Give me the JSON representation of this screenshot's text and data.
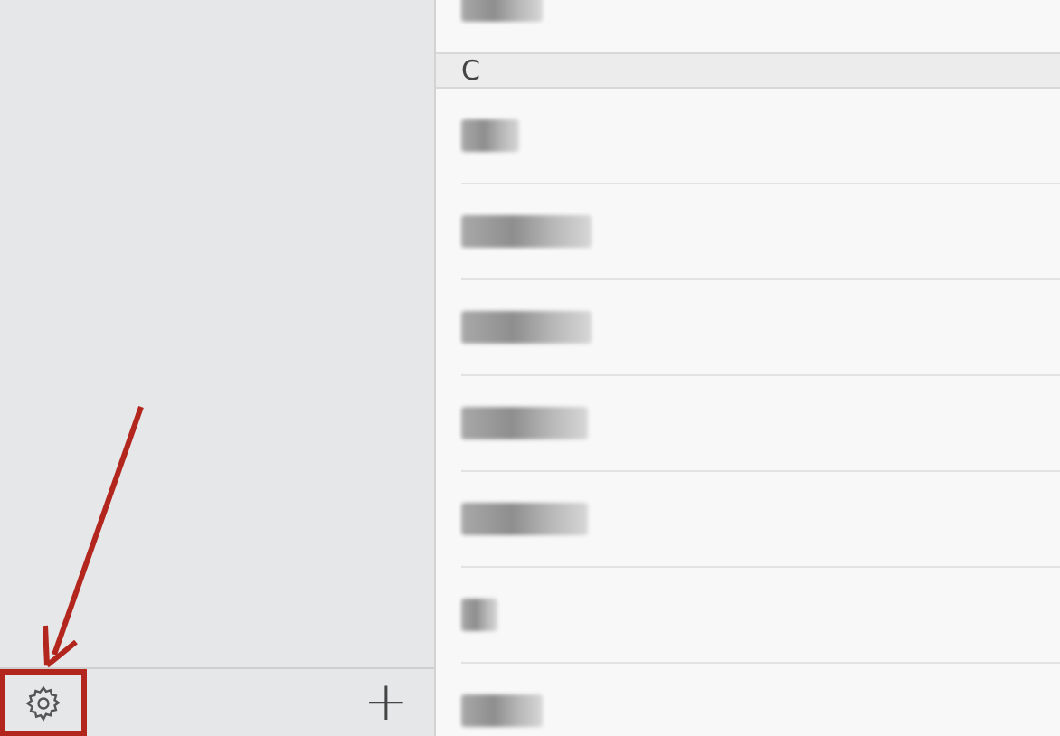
{
  "sidebar": {
    "footer": {
      "settings_highlighted": true,
      "add_label": "+"
    }
  },
  "contacts": {
    "groups": [
      {
        "items": [
          {
            "kind": "obscured"
          }
        ]
      },
      {
        "header": "C",
        "items": [
          {
            "kind": "obscured"
          },
          {
            "kind": "obscured"
          },
          {
            "kind": "obscured"
          },
          {
            "kind": "obscured"
          },
          {
            "kind": "obscured"
          },
          {
            "kind": "obscured"
          },
          {
            "kind": "obscured"
          }
        ]
      }
    ]
  }
}
